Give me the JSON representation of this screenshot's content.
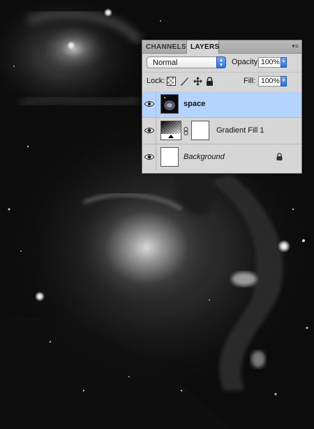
{
  "canvas": {
    "description_icon": "nebula-image"
  },
  "panel": {
    "tabs": [
      {
        "label": "CHANNELS",
        "active": false
      },
      {
        "label": "LAYERS",
        "active": true
      }
    ],
    "blend_mode": "Normal",
    "opacity_label": "Opacity:",
    "opacity_value": "100%",
    "lock_label": "Lock:",
    "fill_label": "Fill:",
    "fill_value": "100%",
    "layers": [
      {
        "name": "space",
        "selected": true,
        "visible": true,
        "style": "bold"
      },
      {
        "name": "Gradient Fill 1",
        "selected": false,
        "visible": true,
        "style": "normal"
      },
      {
        "name": "Background",
        "selected": false,
        "visible": true,
        "style": "italic",
        "locked": true
      }
    ]
  },
  "colors": {
    "selection": "#b5d3ff",
    "panel": "#d6d6d6",
    "accent": "#2f70e0"
  }
}
